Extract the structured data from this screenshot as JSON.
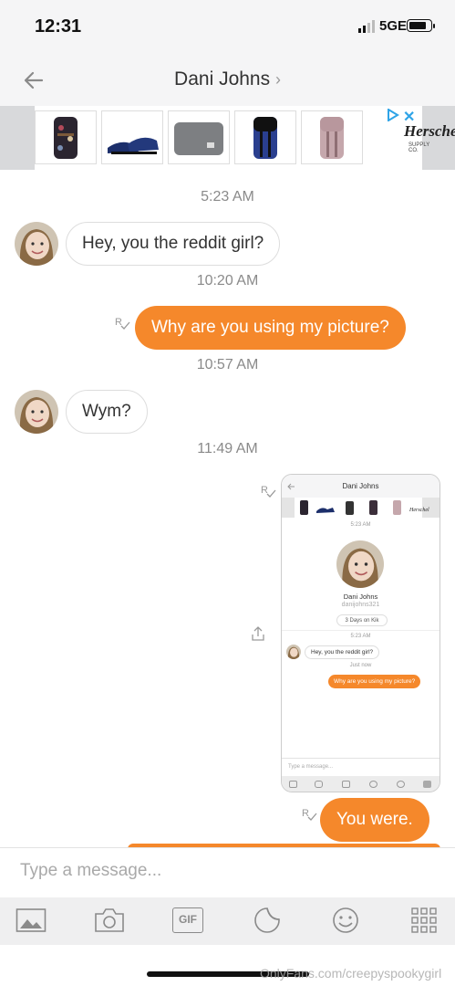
{
  "status_bar": {
    "time": "12:31",
    "network": "5GE"
  },
  "header": {
    "title": "Dani Johns",
    "title_chevron": "›"
  },
  "ad": {
    "brand": "Herschel",
    "brand_sub": "SUPPLY CO.",
    "close_label": "✕"
  },
  "messages": {
    "t1": "5:23 AM",
    "m1": "Hey, you the reddit girl?",
    "t2": "10:20 AM",
    "m2": "Why are you using my picture?",
    "t3": "10:57 AM",
    "m3": "Wym?",
    "t4": "11:49 AM",
    "m5": "You were."
  },
  "embedded_screenshot": {
    "title": "Dani Johns",
    "time1": "5:23 AM",
    "name": "Dani Johns",
    "username": "danijohns321",
    "days": "3 Days on Kik",
    "time2": "5:23 AM",
    "msg_in": "Hey, you the reddit girl?",
    "just_now": "Just now",
    "msg_out": "Why are you using my picture?",
    "input_placeholder": "Type a message..."
  },
  "composer": {
    "placeholder": "Type a message..."
  },
  "toolbar": {
    "gif_label": "GIF"
  },
  "watermark": "OnlyFans.com/creepyspookygirl",
  "colors": {
    "accent": "#f5882b",
    "bubble_border": "#dddddd",
    "bar_bg": "#f5f5f6"
  },
  "icons": [
    "back-arrow-icon",
    "gallery-icon",
    "camera-icon",
    "gif-icon",
    "sticker-icon",
    "emoji-icon",
    "grid-icon",
    "share-icon",
    "read-receipt-icon"
  ]
}
